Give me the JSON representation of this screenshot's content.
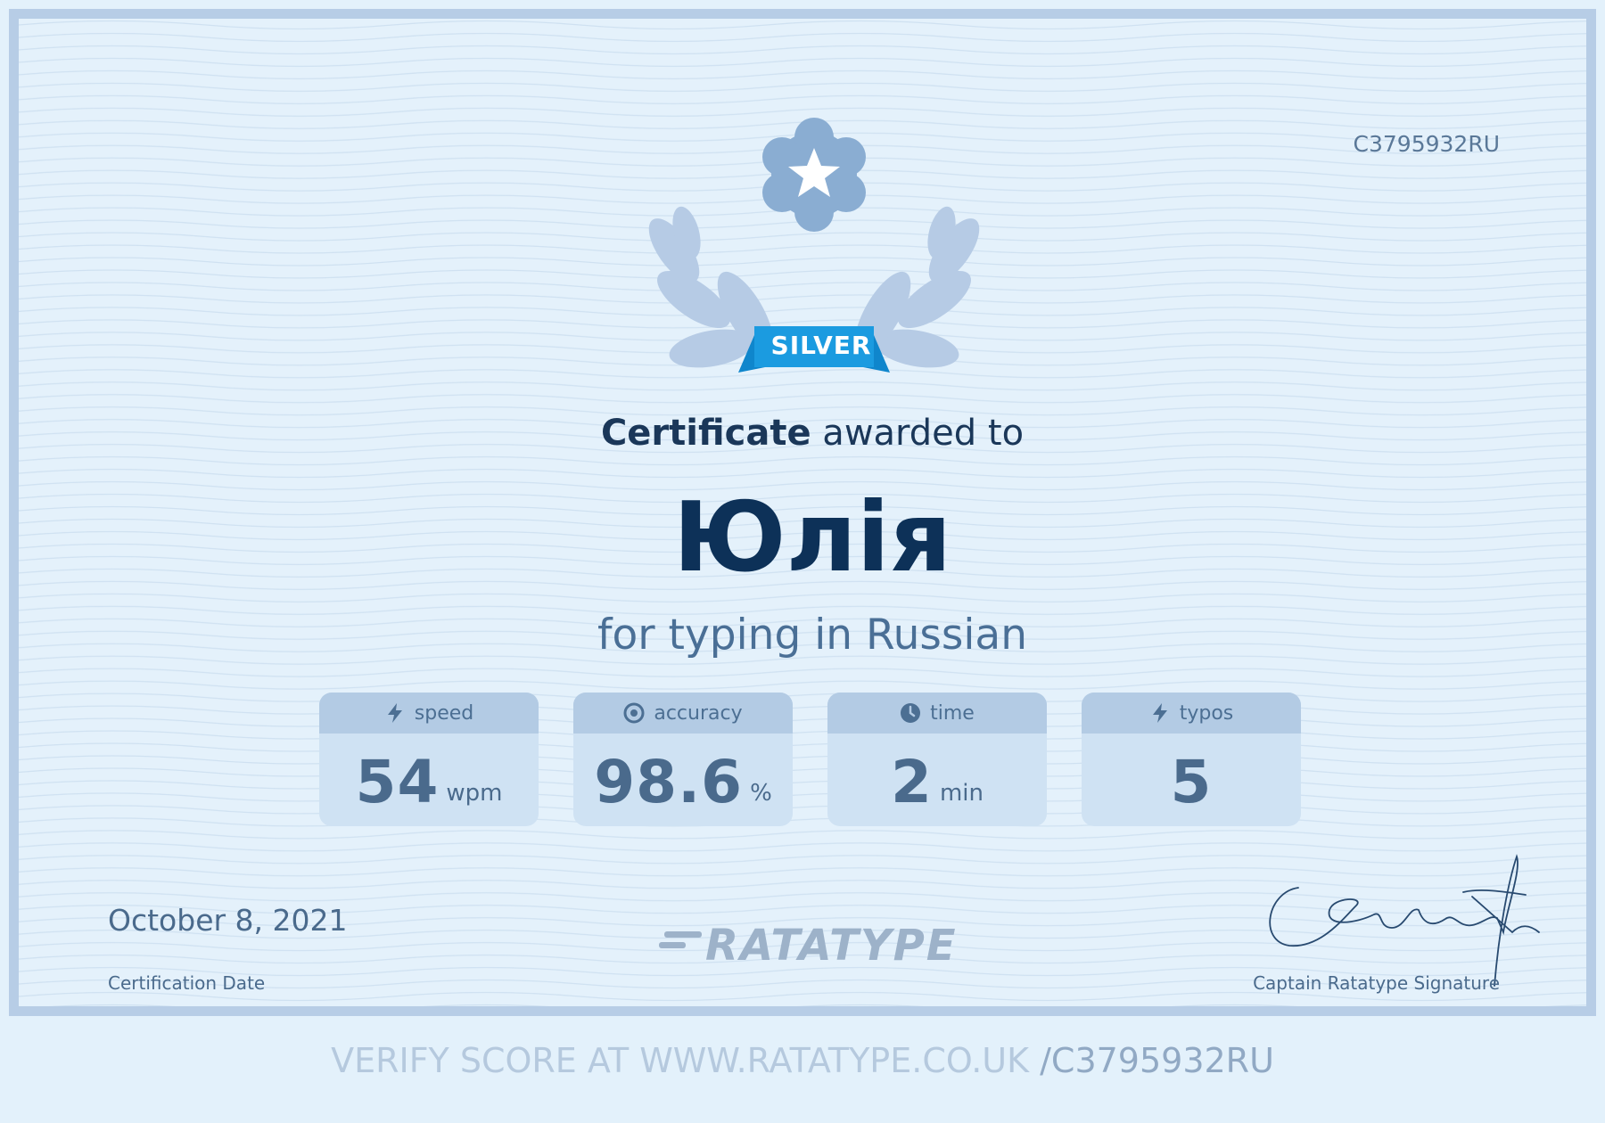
{
  "certificate": {
    "id": "C3795932RU",
    "badge": "SILVER",
    "heading_bold": "Certificate",
    "heading_rest": " awarded to",
    "name": "Юлія",
    "subtitle": "for typing in Russian"
  },
  "stats": [
    {
      "label": "speed",
      "icon": "lightning-icon",
      "value": "54",
      "unit": "wpm"
    },
    {
      "label": "accuracy",
      "icon": "target-icon",
      "value": "98.6",
      "unit": "%"
    },
    {
      "label": "time",
      "icon": "clock-icon",
      "value": "2",
      "unit": "min"
    },
    {
      "label": "typos",
      "icon": "lightning-icon",
      "value": "5",
      "unit": ""
    }
  ],
  "date": {
    "value": "October 8, 2021",
    "label": "Certification Date"
  },
  "logo": "RATATYPE",
  "signature": {
    "label": "Captain Ratatype Signature"
  },
  "footer": {
    "prefix": "VERIFY SCORE AT WWW.RATATYPE.CO.UK ",
    "id": "/C3795932RU"
  },
  "colors": {
    "accent": "#1b9be0",
    "navy": "#0d3158",
    "frame": "#b7cde6"
  }
}
